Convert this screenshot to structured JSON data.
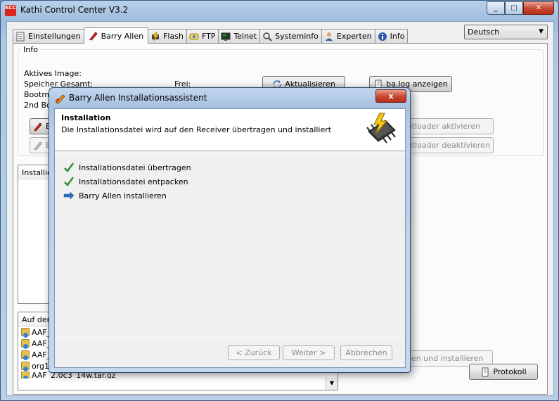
{
  "window": {
    "title": "Kathi Control Center V3.2",
    "icon_text": "KCC"
  },
  "tabs": [
    {
      "label": "Einstellungen",
      "icon": "settings-icon",
      "active": false
    },
    {
      "label": "Barry Allen",
      "icon": "barry-allen-icon",
      "active": true
    },
    {
      "label": "Flash",
      "icon": "flash-icon",
      "active": false
    },
    {
      "label": "FTP",
      "icon": "ftp-icon",
      "active": false
    },
    {
      "label": "Telnet",
      "icon": "telnet-icon",
      "active": false
    },
    {
      "label": "Systeminfo",
      "icon": "systeminfo-icon",
      "active": false
    },
    {
      "label": "Experten",
      "icon": "experten-icon",
      "active": false
    },
    {
      "label": "Info",
      "icon": "info-icon",
      "active": false
    }
  ],
  "language": {
    "selected": "Deutsch"
  },
  "info": {
    "legend": "Info",
    "active_image_label": "Aktives Image:",
    "storage_total_label": "Speicher Gesamt:",
    "free_label": "Frei:",
    "bootmenu_label": "Bootmer",
    "second_boot_label": "2nd Boo",
    "refresh_button": "Aktualisieren",
    "balog_button": "ba.log anzeigen",
    "ba_button_1": "BA",
    "ba_button_2": "BA",
    "bootloader_activate": "otloader aktivieren",
    "bootloader_deactivate": "otloader deaktivieren"
  },
  "installed": {
    "header": "Installiert"
  },
  "files": {
    "header": "Auf dem",
    "items": [
      "AAF_",
      "AAF_",
      "AAF_",
      "org1.",
      "AAF_2.0c3_14w.tar.gz"
    ]
  },
  "bottom": {
    "download_install": "den und installieren",
    "protokoll_button": "Protokoll"
  },
  "dialog": {
    "title": "Barry Allen Installationsassistent",
    "close_label": "x",
    "header_title": "Installation",
    "header_subtitle": "Die Installationsdatei wird auf den Receiver übertragen und installiert",
    "steps": [
      {
        "label": "Installationsdatei übertragen",
        "status": "done"
      },
      {
        "label": "Installationsdatei entpacken",
        "status": "done"
      },
      {
        "label": "Barry Allen installieren",
        "status": "current"
      }
    ],
    "buttons": {
      "back": "< Zurück",
      "next": "Weiter >",
      "cancel": "Abbrechen"
    }
  },
  "colors": {
    "accent": "#d6261f",
    "check": "#2f8f2f",
    "arrow": "#2e6dc2"
  }
}
